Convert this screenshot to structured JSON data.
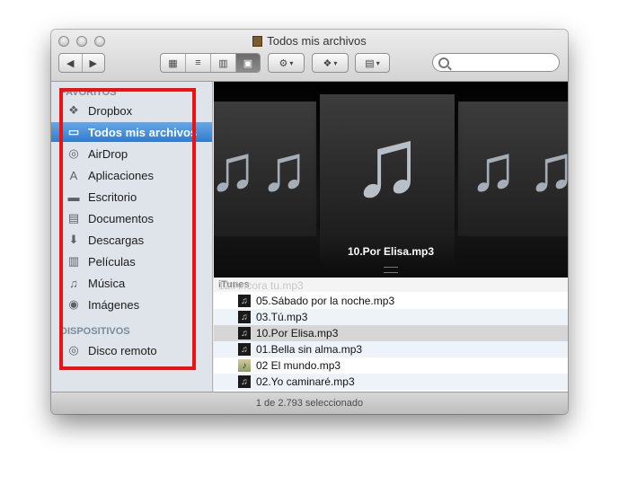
{
  "window": {
    "title": "Todos mis archivos"
  },
  "toolbar": {
    "back_glyph": "◀",
    "forward_glyph": "▶",
    "views": [
      {
        "name": "icon-view",
        "glyph": "▦"
      },
      {
        "name": "list-view",
        "glyph": "≡"
      },
      {
        "name": "column-view",
        "glyph": "▥"
      },
      {
        "name": "coverflow-view",
        "glyph": "▣"
      }
    ],
    "action_glyph": "⚙",
    "dropbox_glyph": "❖",
    "arrange_glyph": "▤",
    "caret": "▾"
  },
  "sidebar": {
    "favorites_header": "FAVORITOS",
    "items": [
      {
        "label": "Dropbox",
        "icon": "❖"
      },
      {
        "label": "Todos mis archivos",
        "icon": "▭"
      },
      {
        "label": "AirDrop",
        "icon": "◎"
      },
      {
        "label": "Aplicaciones",
        "icon": "A"
      },
      {
        "label": "Escritorio",
        "icon": "▬"
      },
      {
        "label": "Documentos",
        "icon": "▤"
      },
      {
        "label": "Descargas",
        "icon": "⬇"
      },
      {
        "label": "Películas",
        "icon": "▥"
      },
      {
        "label": "Música",
        "icon": "♫"
      },
      {
        "label": "Imágenes",
        "icon": "◉"
      }
    ],
    "devices_header": "DISPOSITIVOS",
    "devices": [
      {
        "label": "Disco remoto",
        "icon": "◎"
      }
    ]
  },
  "coverflow": {
    "note_glyph": "♫",
    "caption": "10.Por Elisa.mp3"
  },
  "list": {
    "group_header": "iTunes",
    "ghost_row": "12.Ancora tu.mp3",
    "rows": [
      {
        "name": "05.Sábado por la noche.mp3",
        "icon": "♫"
      },
      {
        "name": "03.Tú.mp3",
        "icon": "♫"
      },
      {
        "name": "10.Por Elisa.mp3",
        "icon": "♫"
      },
      {
        "name": "01.Bella sin alma.mp3",
        "icon": "♫"
      },
      {
        "name": "02 El mundo.mp3",
        "icon": "♪"
      },
      {
        "name": "02.Yo caminaré.mp3",
        "icon": "♫"
      }
    ],
    "selected_index": 2
  },
  "status": {
    "text": "1 de 2.793 seleccionado"
  }
}
